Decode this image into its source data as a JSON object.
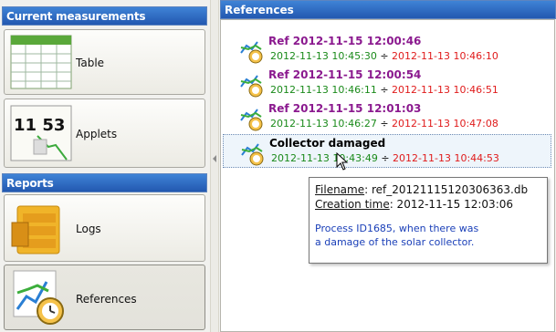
{
  "left": {
    "current_header": "Current measurements",
    "table_label": "Table",
    "applets_label": "Applets",
    "applets_clock_text": "11 53",
    "reports_header": "Reports",
    "logs_label": "Logs",
    "references_label": "References"
  },
  "right": {
    "header": "References",
    "items": [
      {
        "title": "Ref 2012-11-15 12:00:46",
        "start": "2012-11-13 10:45:30",
        "sep": "÷",
        "end": "2012-11-13 10:46:10"
      },
      {
        "title": "Ref 2012-11-15 12:00:54",
        "start": "2012-11-13 10:46:11",
        "sep": "÷",
        "end": "2012-11-13 10:46:51"
      },
      {
        "title": "Ref 2012-11-15 12:01:03",
        "start": "2012-11-13 10:46:27",
        "sep": "÷",
        "end": "2012-11-13 10:47:08"
      },
      {
        "title": "Collector damaged",
        "start": "2012-11-13 10:43:49",
        "sep": "÷",
        "end": "2012-11-13 10:44:53"
      }
    ]
  },
  "tooltip": {
    "filename_key": "Filename",
    "filename_value": ": ref_20121115120306363.db",
    "creation_key": "Creation time",
    "creation_value": ": 2012-11-15 12:03:06",
    "desc_line1": "Process ID1685, when there was",
    "desc_line2": "a damage of the solar collector."
  },
  "colors": {
    "header_blue": "#2f6cc6",
    "ref_title_purple": "#8b1a8f",
    "date_green": "#1a8a1a",
    "date_red": "#e01b1b",
    "tooltip_desc_blue": "#1a3fb8"
  }
}
